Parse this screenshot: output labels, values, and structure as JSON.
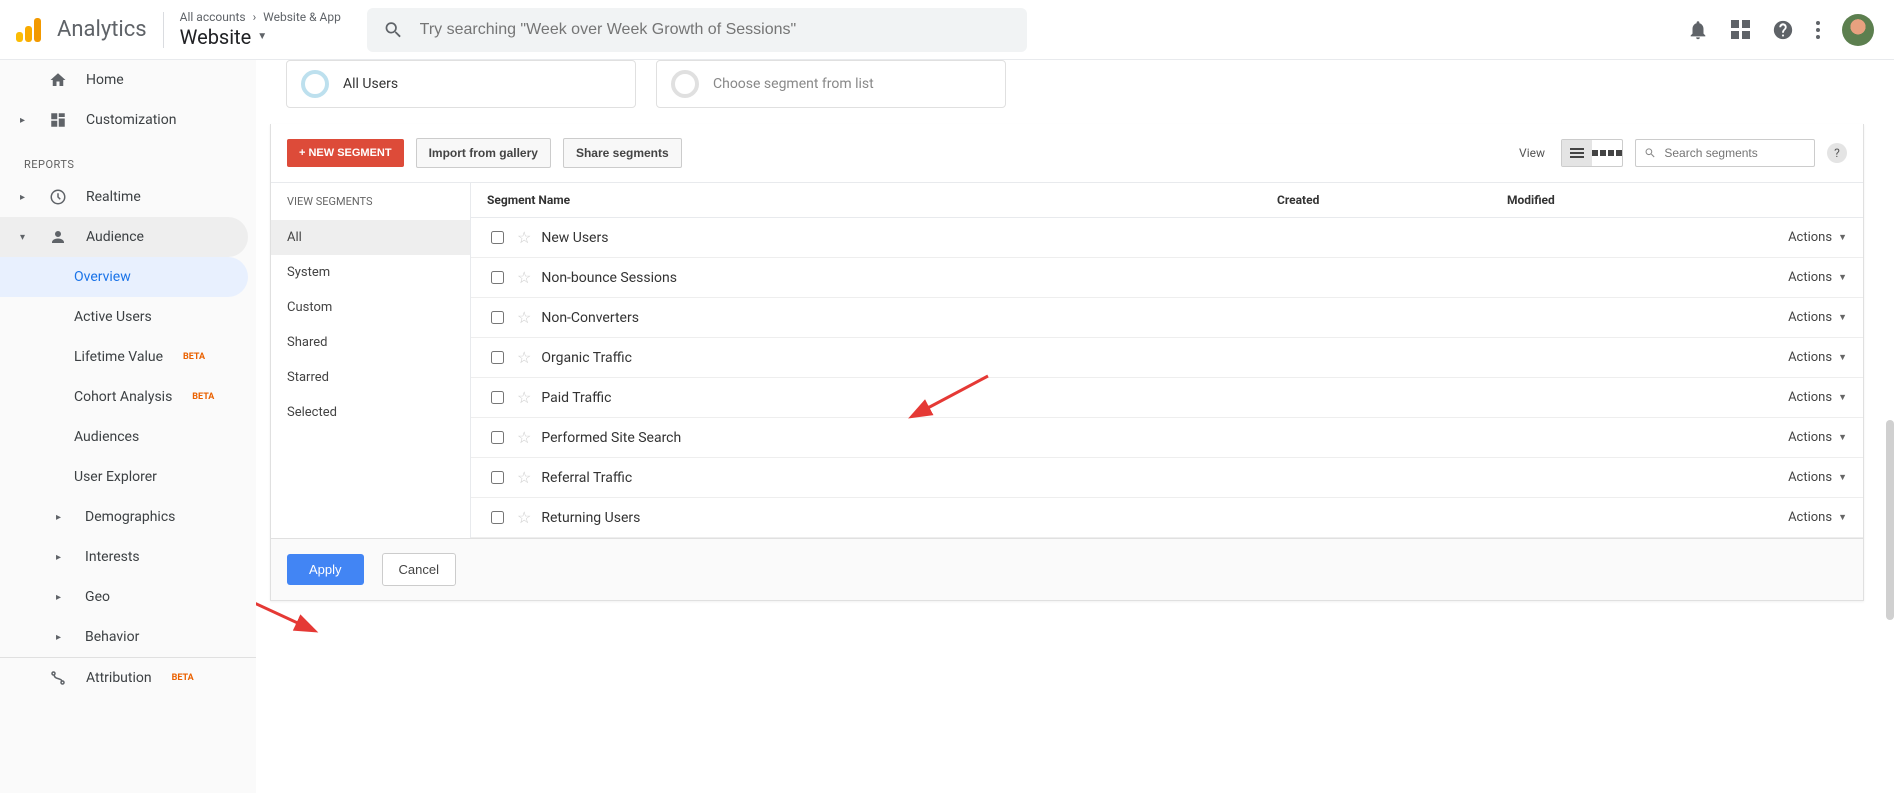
{
  "header": {
    "brand": "Analytics",
    "crumb1": "All accounts",
    "crumb2": "Website & App",
    "account": "Website",
    "search_placeholder": "Try searching \"Week over Week Growth of Sessions\""
  },
  "sidebar": {
    "home": "Home",
    "customization": "Customization",
    "reports_label": "REPORTS",
    "realtime": "Realtime",
    "audience": "Audience",
    "overview": "Overview",
    "active_users": "Active Users",
    "lifetime_value": "Lifetime Value",
    "cohort": "Cohort Analysis",
    "audiences": "Audiences",
    "user_explorer": "User Explorer",
    "demographics": "Demographics",
    "interests": "Interests",
    "geo": "Geo",
    "behavior": "Behavior",
    "attribution": "Attribution",
    "beta": "BETA"
  },
  "chips": {
    "all_users": "All Users",
    "choose": "Choose segment from list"
  },
  "toolbar": {
    "new_segment": "+ NEW SEGMENT",
    "import": "Import from gallery",
    "share": "Share segments",
    "view_label": "View",
    "search_placeholder": "Search segments"
  },
  "left_filters": {
    "header": "VIEW SEGMENTS",
    "items": [
      "All",
      "System",
      "Custom",
      "Shared",
      "Starred",
      "Selected"
    ]
  },
  "table": {
    "col_name": "Segment Name",
    "col_created": "Created",
    "col_modified": "Modified",
    "actions_label": "Actions",
    "rows": [
      "New Users",
      "Non-bounce Sessions",
      "Non-Converters",
      "Organic Traffic",
      "Paid Traffic",
      "Performed Site Search",
      "Referral Traffic",
      "Returning Users"
    ]
  },
  "footer": {
    "apply": "Apply",
    "cancel": "Cancel"
  }
}
